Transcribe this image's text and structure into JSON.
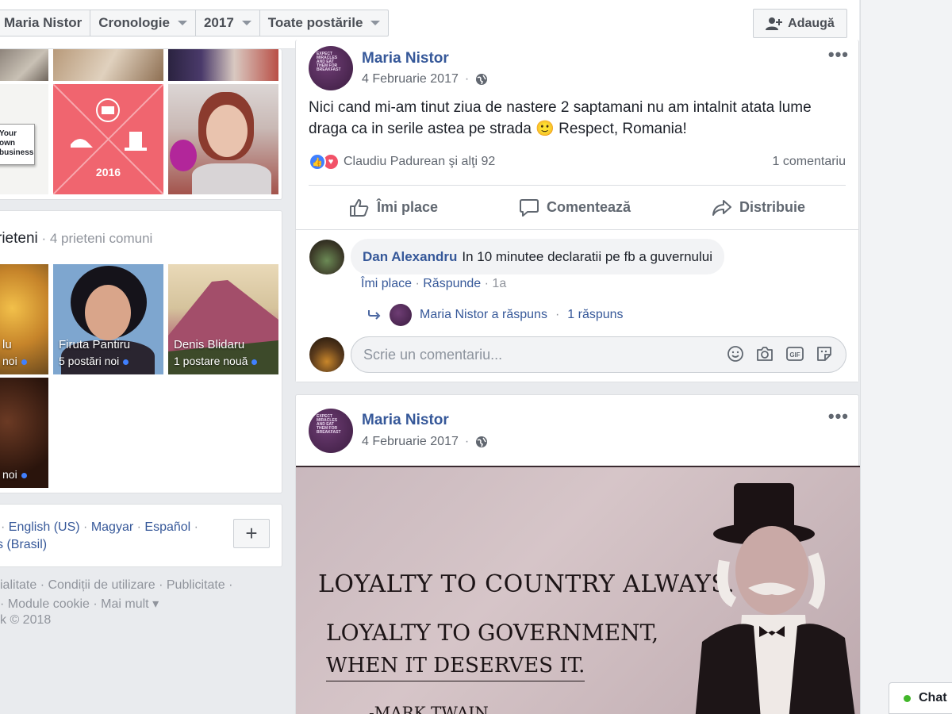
{
  "filter_bar": {
    "profile_name": "Maria Nistor",
    "timeline": "Cronologie",
    "year": "2017",
    "posts_filter": "Toate postările",
    "add_button": "Adaugă"
  },
  "photos": {
    "year_badge": "2016",
    "sign_text": "Your\nown\nbusiness"
  },
  "friends": {
    "title": "rieteni",
    "subtitle": "4 prieteni comuni",
    "items": [
      {
        "name": "lu",
        "posts": "noi"
      },
      {
        "name": "Firuta Pantiru",
        "posts": "5 postări noi"
      },
      {
        "name": "Denis Blidaru",
        "posts": "1 postare nouă"
      },
      {
        "name": "",
        "posts": "noi"
      }
    ]
  },
  "languages": {
    "line1": [
      "English (US)",
      "Magyar",
      "Español"
    ],
    "line2": "s (Brasil)",
    "more_button": "+"
  },
  "footer": {
    "line1": "ialitate · Condiții de utilizare · Publicitate ·",
    "line2": "· Module cookie · Mai mult ▾",
    "line3": "k © 2018"
  },
  "post1": {
    "author": "Maria Nistor",
    "date": "4 Februarie 2017",
    "more": "•••",
    "text": "Nici cand mi-am tinut ziua de nastere 2 saptamani nu am intalnit atata lume draga ca in serile astea pe strada 🙂 Respect, Romania!",
    "reactions_text": "Claudiu Padurean şi alţi 92",
    "comments_count": "1 comentariu",
    "actions": {
      "like": "Îmi place",
      "comment": "Comentează",
      "share": "Distribuie"
    },
    "comment": {
      "author": "Dan Alexandru",
      "text": "In 10 minutee declaratii pe fb a guvernului",
      "like": "Îmi place",
      "reply": "Răspunde",
      "time": "1a"
    },
    "reply_summary": {
      "author": "Maria Nistor a răspuns",
      "count": "1 răspuns"
    },
    "write_placeholder": "Scrie un comentariu..."
  },
  "post2": {
    "author": "Maria Nistor",
    "date": "4 Februarie 2017",
    "more": "•••",
    "image_text": {
      "line1": "LOYALTY TO COUNTRY ALWAYS.",
      "line2": "LOYALTY TO GOVERNMENT,",
      "line3": "WHEN IT DESERVES IT.",
      "signature": "-MARK TWAIN"
    }
  },
  "chat": {
    "label": "Chat"
  },
  "colors": {
    "link": "#365899",
    "like_blue": "#4080ff",
    "love_red": "#f25268",
    "online_green": "#42b72a"
  }
}
